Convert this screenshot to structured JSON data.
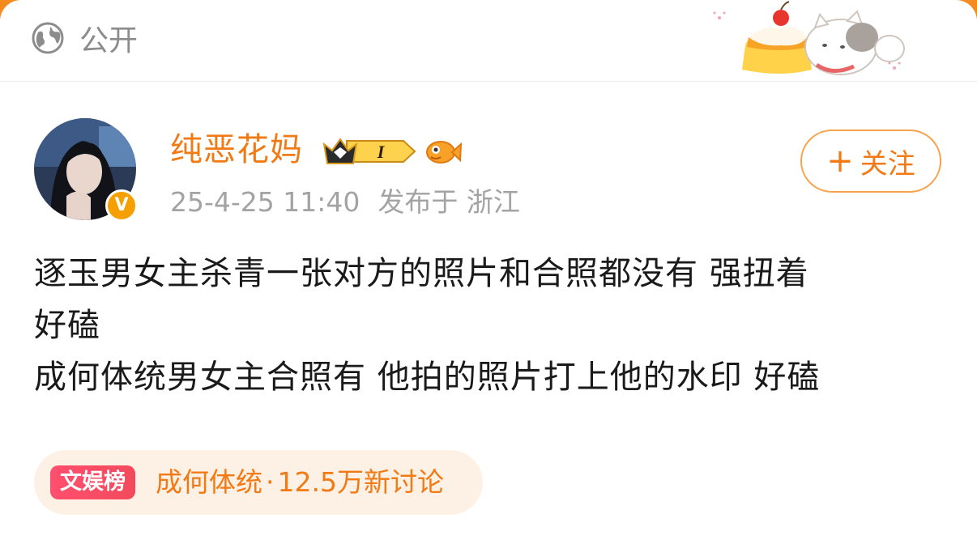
{
  "header": {
    "visibility_label": "公开",
    "visibility_icon": "globe-icon"
  },
  "post": {
    "author": {
      "name": "纯恶花妈",
      "verified_badge_letter": "V",
      "level_badge": "I"
    },
    "meta": {
      "timestamp": "25-4-25 11:40",
      "published_label": "发布于 浙江"
    },
    "follow_button": {
      "plus": "+",
      "label": "关注"
    },
    "text_lines": [
      "逐玉男女主杀青一张对方的照片和合照都没有 强扭着",
      "好磕",
      "成何体统男女主合照有 他拍的照片打上他的水印 好磕"
    ]
  },
  "topic": {
    "tag": "文娱榜",
    "title": "成何体统",
    "separator": "·",
    "discussions": "12.5万新讨论"
  },
  "colors": {
    "accent": "#f27a14",
    "tag_red": "#f24a5c",
    "chip_bg": "#fdf0e4",
    "frame": "#f58a1f"
  }
}
